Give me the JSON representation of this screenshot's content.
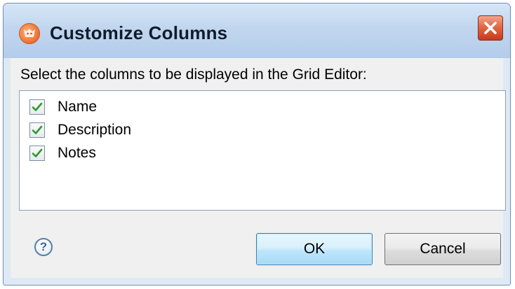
{
  "window": {
    "title": "Customize Columns",
    "app_icon": "app-logo-icon",
    "close_icon": "close-icon"
  },
  "dialog": {
    "instruction": "Select the columns to be displayed in the Grid Editor:",
    "columns": [
      {
        "label": "Name",
        "checked": true
      },
      {
        "label": "Description",
        "checked": true
      },
      {
        "label": "Notes",
        "checked": true
      }
    ],
    "help_icon": "help-icon",
    "help_glyph": "?"
  },
  "buttons": {
    "ok_label": "OK",
    "cancel_label": "Cancel"
  },
  "colors": {
    "checkmark": "#2a9d2a",
    "default_button_border": "#3c7fb1",
    "close_button": "#d9502e"
  }
}
